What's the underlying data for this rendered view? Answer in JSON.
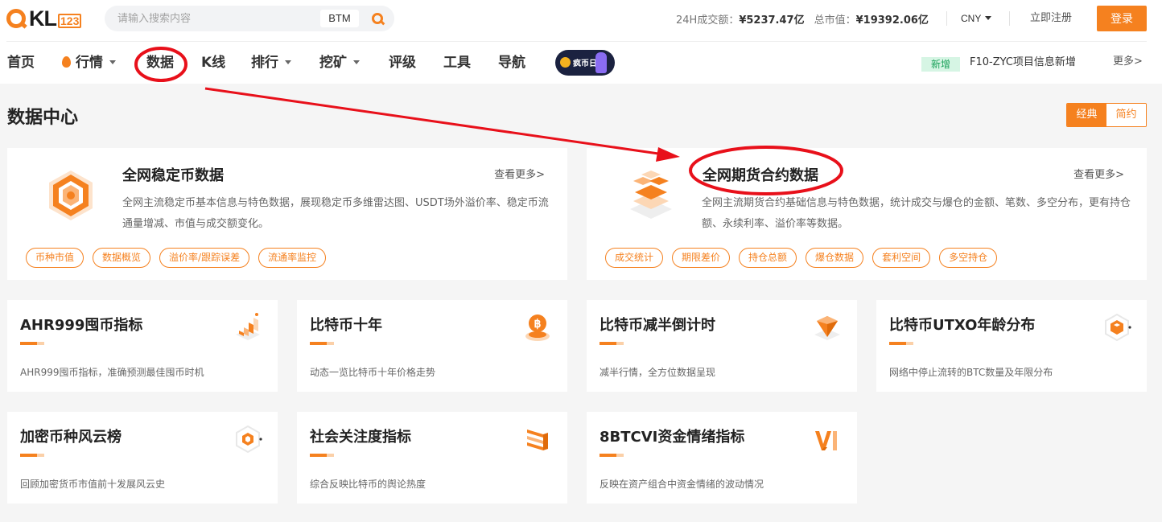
{
  "header": {
    "logo_text": "QKL123",
    "search": {
      "placeholder": "请输入搜索内容",
      "tag": "BTM"
    },
    "stats": {
      "volume_label": "24H成交额：",
      "volume_value": "¥5237.47亿",
      "marketcap_label": "总市值：",
      "marketcap_value": "¥19392.06亿"
    },
    "currency": "CNY",
    "register": "立即注册",
    "login": "登录"
  },
  "nav": {
    "items": [
      "首页",
      "行情",
      "数据",
      "K线",
      "排行",
      "挖矿",
      "评级",
      "工具",
      "导航"
    ],
    "promo_text": "疯币日",
    "new_badge": "新增",
    "news_text": "F10-ZYC项目信息新增",
    "more": "更多>"
  },
  "page": {
    "title": "数据中心",
    "view_toggle": [
      "经典",
      "简约"
    ]
  },
  "big_cards": [
    {
      "title": "全网稳定币数据",
      "more": "查看更多>",
      "desc": "全网主流稳定币基本信息与特色数据，展现稳定币多维雷达图、USDT场外溢价率、稳定币流通量增减、市值与成交额变化。",
      "tags": [
        "币种市值",
        "数据概览",
        "溢价率/跟踪误差",
        "流通率监控"
      ]
    },
    {
      "title": "全网期货合约数据",
      "more": "查看更多>",
      "desc": "全网主流期货合约基础信息与特色数据，统计成交与爆仓的金额、笔数、多空分布，更有持仓额、永续利率、溢价率等数据。",
      "tags": [
        "成交统计",
        "期限差价",
        "持仓总额",
        "爆仓数据",
        "套利空间",
        "多空持仓"
      ]
    }
  ],
  "small_cards": [
    {
      "title": "AHR999囤币指标",
      "desc": "AHR999囤币指标，准确预测最佳囤币时机",
      "icon": "stairs-icon"
    },
    {
      "title": "比特币十年",
      "desc": "动态一览比特币十年价格走势",
      "icon": "bitcoin-icon"
    },
    {
      "title": "比特币减半倒计时",
      "desc": "减半行情，全方位数据呈现",
      "icon": "diamond-icon"
    },
    {
      "title": "比特币UTXO年龄分布",
      "desc": "网络中停止流转的BTC数量及年限分布",
      "icon": "hexagon-icon"
    },
    {
      "title": "加密币种风云榜",
      "desc": "回顾加密货币市值前十发展风云史",
      "icon": "hexagon-ranking-icon"
    },
    {
      "title": "社会关注度指标",
      "desc": "综合反映比特币的舆论热度",
      "icon": "bars-icon"
    },
    {
      "title": "8BTCVI资金情绪指标",
      "desc": "反映在资产组合中资金情绪的波动情况",
      "icon": "vi-icon"
    }
  ],
  "colors": {
    "accent": "#f5811f",
    "annotation": "#e8101a"
  }
}
